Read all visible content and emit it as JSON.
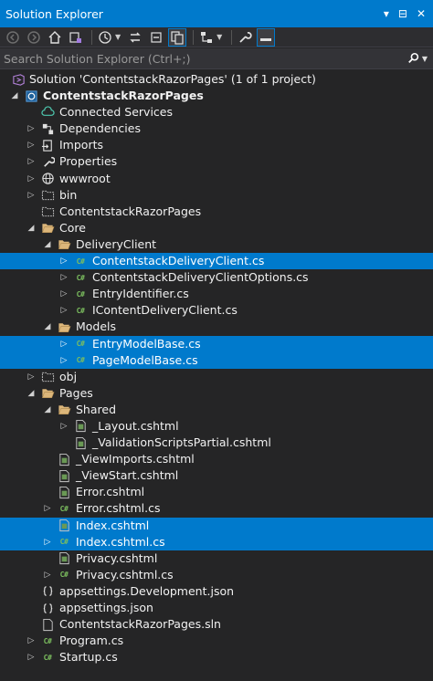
{
  "window": {
    "title": "Solution Explorer",
    "controls": [
      "▾",
      "⊟",
      "✕"
    ]
  },
  "search": {
    "placeholder": "Search Solution Explorer (Ctrl+;)"
  },
  "colors": {
    "accent": "#007acc",
    "background": "#252526",
    "csharp": "#7cbf5f",
    "folder": "#dcb67a"
  },
  "tree": [
    {
      "label": "Solution 'ContentstackRazorPages' (1 of 1 project)",
      "icon": "solution-icon",
      "depth": 0,
      "expander": "none",
      "selected": false,
      "bold": false
    },
    {
      "label": "ContentstackRazorPages",
      "icon": "web-project-icon",
      "depth": 0,
      "expander": "expanded",
      "selected": false,
      "bold": true
    },
    {
      "label": "Connected Services",
      "icon": "connected-services-icon",
      "depth": 1,
      "expander": "none",
      "selected": false,
      "bold": false
    },
    {
      "label": "Dependencies",
      "icon": "dependencies-icon",
      "depth": 1,
      "expander": "collapsed",
      "selected": false,
      "bold": false
    },
    {
      "label": "Imports",
      "icon": "imports-icon",
      "depth": 1,
      "expander": "collapsed",
      "selected": false,
      "bold": false
    },
    {
      "label": "Properties",
      "icon": "properties-icon",
      "depth": 1,
      "expander": "collapsed",
      "selected": false,
      "bold": false
    },
    {
      "label": "wwwroot",
      "icon": "globe-icon",
      "depth": 1,
      "expander": "collapsed",
      "selected": false,
      "bold": false
    },
    {
      "label": "bin",
      "icon": "folder-outline-icon",
      "depth": 1,
      "expander": "collapsed",
      "selected": false,
      "bold": false
    },
    {
      "label": "ContentstackRazorPages",
      "icon": "folder-outline-icon",
      "depth": 1,
      "expander": "none",
      "selected": false,
      "bold": false
    },
    {
      "label": "Core",
      "icon": "folder-open-icon",
      "depth": 1,
      "expander": "expanded",
      "selected": false,
      "bold": false
    },
    {
      "label": "DeliveryClient",
      "icon": "folder-open-icon",
      "depth": 2,
      "expander": "expanded",
      "selected": false,
      "bold": false
    },
    {
      "label": "ContentstackDeliveryClient.cs",
      "icon": "csharp-file-icon",
      "depth": 3,
      "expander": "collapsed",
      "selected": true,
      "bold": false
    },
    {
      "label": "ContentstackDeliveryClientOptions.cs",
      "icon": "csharp-file-icon",
      "depth": 3,
      "expander": "collapsed",
      "selected": false,
      "bold": false
    },
    {
      "label": "EntryIdentifier.cs",
      "icon": "csharp-file-icon",
      "depth": 3,
      "expander": "collapsed",
      "selected": false,
      "bold": false
    },
    {
      "label": "IContentDeliveryClient.cs",
      "icon": "csharp-file-icon",
      "depth": 3,
      "expander": "collapsed",
      "selected": false,
      "bold": false
    },
    {
      "label": "Models",
      "icon": "folder-open-icon",
      "depth": 2,
      "expander": "expanded",
      "selected": false,
      "bold": false
    },
    {
      "label": "EntryModelBase.cs",
      "icon": "csharp-file-icon",
      "depth": 3,
      "expander": "collapsed",
      "selected": true,
      "bold": false
    },
    {
      "label": "PageModelBase.cs",
      "icon": "csharp-file-icon",
      "depth": 3,
      "expander": "collapsed",
      "selected": true,
      "bold": false
    },
    {
      "label": "obj",
      "icon": "folder-outline-icon",
      "depth": 1,
      "expander": "collapsed",
      "selected": false,
      "bold": false
    },
    {
      "label": "Pages",
      "icon": "folder-open-icon",
      "depth": 1,
      "expander": "expanded",
      "selected": false,
      "bold": false
    },
    {
      "label": "Shared",
      "icon": "folder-open-icon",
      "depth": 2,
      "expander": "expanded",
      "selected": false,
      "bold": false
    },
    {
      "label": "_Layout.cshtml",
      "icon": "cshtml-file-icon",
      "depth": 3,
      "expander": "collapsed",
      "selected": false,
      "bold": false
    },
    {
      "label": "_ValidationScriptsPartial.cshtml",
      "icon": "cshtml-file-icon",
      "depth": 3,
      "expander": "none",
      "selected": false,
      "bold": false
    },
    {
      "label": "_ViewImports.cshtml",
      "icon": "cshtml-file-icon",
      "depth": 2,
      "expander": "none",
      "selected": false,
      "bold": false
    },
    {
      "label": "_ViewStart.cshtml",
      "icon": "cshtml-file-icon",
      "depth": 2,
      "expander": "none",
      "selected": false,
      "bold": false
    },
    {
      "label": "Error.cshtml",
      "icon": "cshtml-file-icon",
      "depth": 2,
      "expander": "none",
      "selected": false,
      "bold": false
    },
    {
      "label": "Error.cshtml.cs",
      "icon": "csharp-file-icon",
      "depth": 2,
      "expander": "collapsed",
      "selected": false,
      "bold": false
    },
    {
      "label": "Index.cshtml",
      "icon": "cshtml-file-icon",
      "depth": 2,
      "expander": "none",
      "selected": true,
      "bold": false
    },
    {
      "label": "Index.cshtml.cs",
      "icon": "csharp-file-icon",
      "depth": 2,
      "expander": "collapsed",
      "selected": true,
      "bold": false
    },
    {
      "label": "Privacy.cshtml",
      "icon": "cshtml-file-icon",
      "depth": 2,
      "expander": "none",
      "selected": false,
      "bold": false
    },
    {
      "label": "Privacy.cshtml.cs",
      "icon": "csharp-file-icon",
      "depth": 2,
      "expander": "collapsed",
      "selected": false,
      "bold": false
    },
    {
      "label": "appsettings.Development.json",
      "icon": "json-file-icon",
      "depth": 1,
      "expander": "none",
      "selected": false,
      "bold": false
    },
    {
      "label": "appsettings.json",
      "icon": "json-file-icon",
      "depth": 1,
      "expander": "none",
      "selected": false,
      "bold": false
    },
    {
      "label": "ContentstackRazorPages.sln",
      "icon": "file-icon",
      "depth": 1,
      "expander": "none",
      "selected": false,
      "bold": false
    },
    {
      "label": "Program.cs",
      "icon": "csharp-file-icon",
      "depth": 1,
      "expander": "collapsed",
      "selected": false,
      "bold": false
    },
    {
      "label": "Startup.cs",
      "icon": "csharp-file-icon",
      "depth": 1,
      "expander": "collapsed",
      "selected": false,
      "bold": false
    }
  ]
}
